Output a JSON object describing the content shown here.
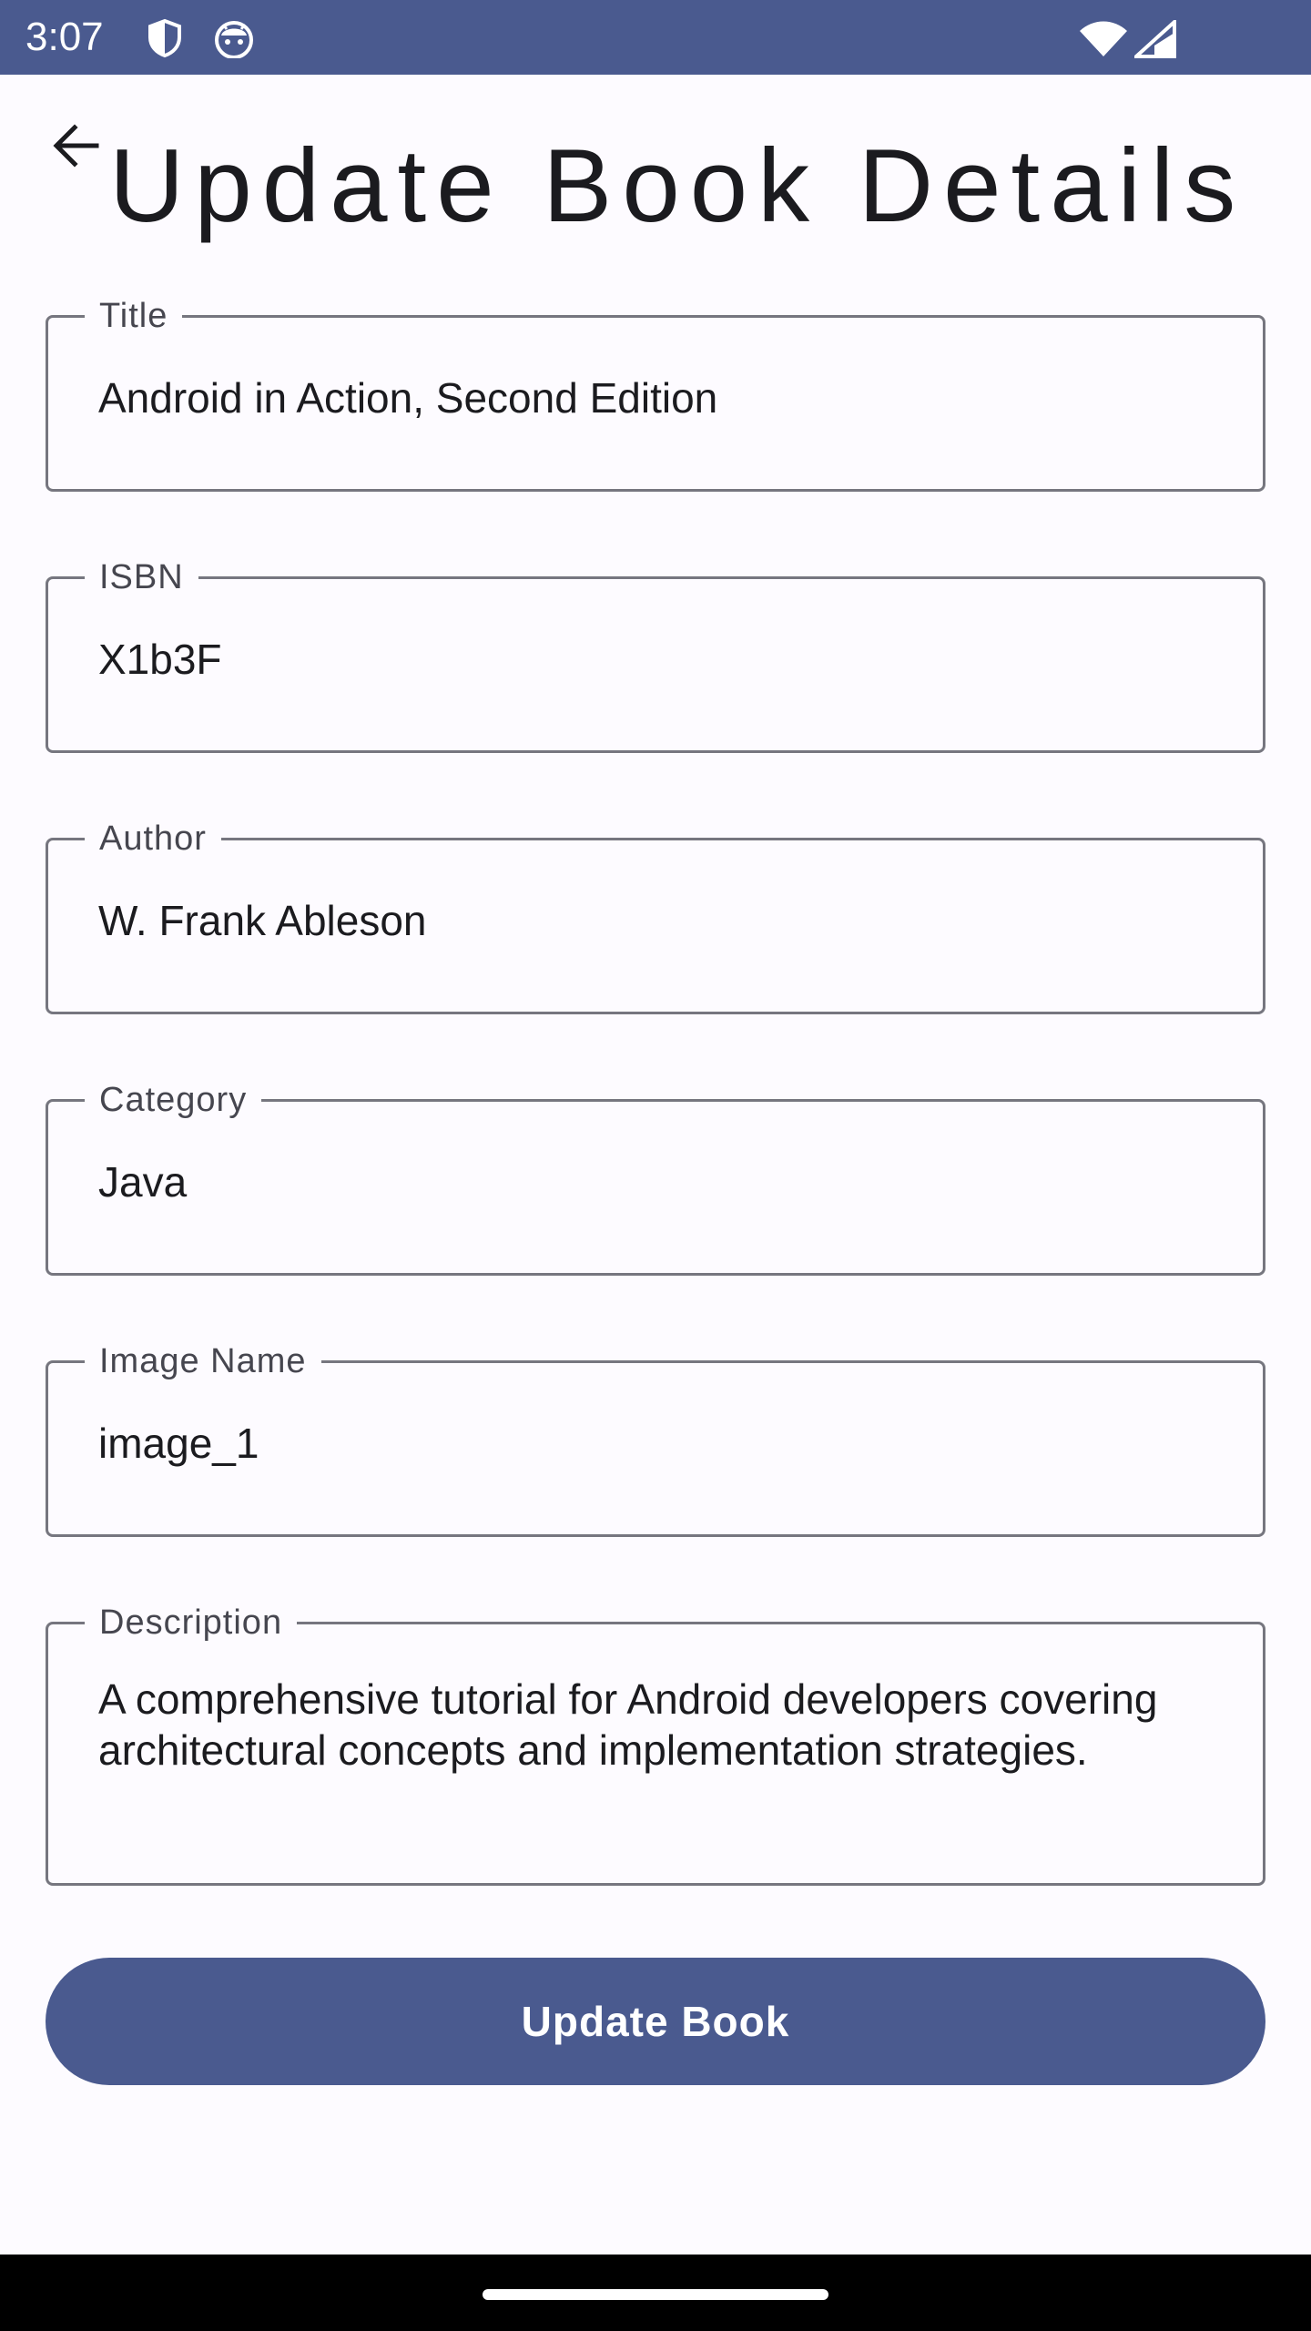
{
  "status_bar": {
    "time": "3:07",
    "icons": [
      "shield-icon",
      "android-face-icon",
      "wifi-icon",
      "signal-icon"
    ],
    "background": "#4a5a8f"
  },
  "app_bar": {
    "back_icon": "arrow-back-icon",
    "title": "Update Book Details"
  },
  "form": {
    "fields": [
      {
        "label": "Title",
        "value": "Android in Action, Second Edition"
      },
      {
        "label": "ISBN",
        "value": "X1b3F"
      },
      {
        "label": "Author",
        "value": "W. Frank Ableson"
      },
      {
        "label": "Category",
        "value": "Java"
      },
      {
        "label": "Image Name",
        "value": "image_1"
      },
      {
        "label": "Description",
        "value": "A comprehensive tutorial for Android developers covering architectural concepts and implementation strategies."
      }
    ]
  },
  "actions": {
    "update_label": "Update Book",
    "accent_color": "#4a5a8f"
  }
}
